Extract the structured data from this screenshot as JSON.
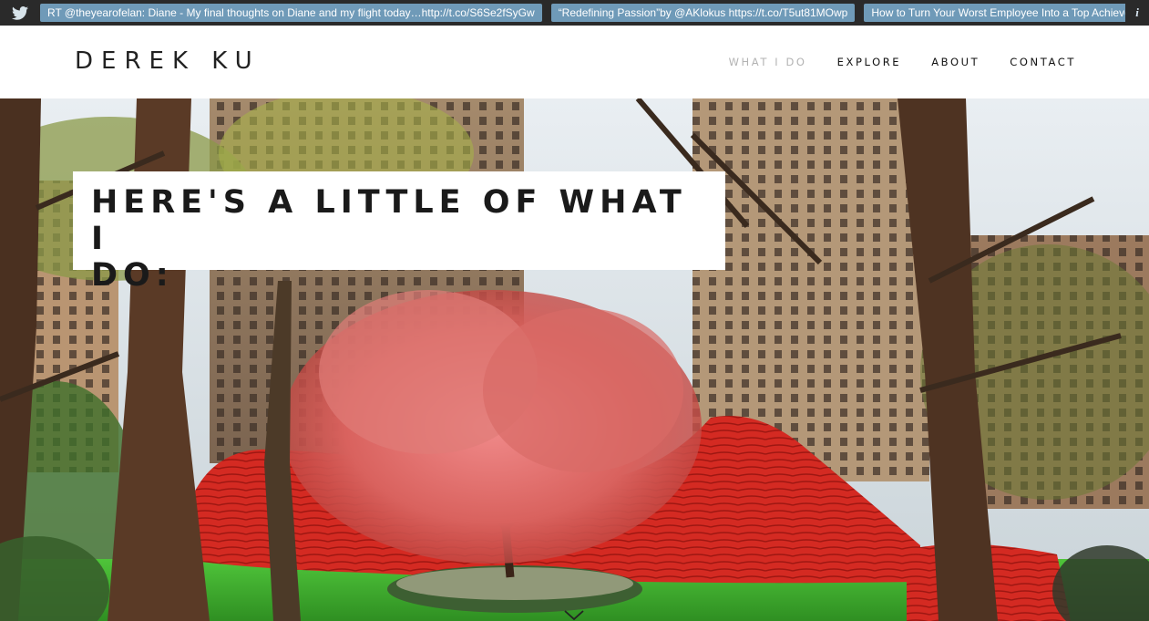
{
  "ticker": {
    "icon": "twitter-bird-icon",
    "tweets": [
      "RT @theyearofelan: Diane - My final thoughts on Diane and my flight today…http://t.co/S6Se2fSyGw",
      "“Redefining Passion”by @AKlokus https://t.co/T5ut81MOwp",
      "How to Turn Your Worst Employee Into a Top Achiever"
    ],
    "info_label": "i"
  },
  "header": {
    "logo": "DEREK KU",
    "nav": [
      {
        "label": "WHAT I DO",
        "active": true
      },
      {
        "label": "EXPLORE",
        "active": false
      },
      {
        "label": "ABOUT",
        "active": false
      },
      {
        "label": "CONTACT",
        "active": false
      }
    ]
  },
  "hero": {
    "title_line1": "HERE'S A LITTLE OF WHAT I",
    "title_line2": "DO:",
    "image_description": "park-with-cherry-tree-and-red-installation",
    "scroll_icon": "chevron-down-icon"
  },
  "colors": {
    "ticker_bg": "#2a2a2a",
    "tweet_bg": "#6f9ab8",
    "nav_active": "#b3b3b3",
    "text_dark": "#1a1a1a"
  }
}
